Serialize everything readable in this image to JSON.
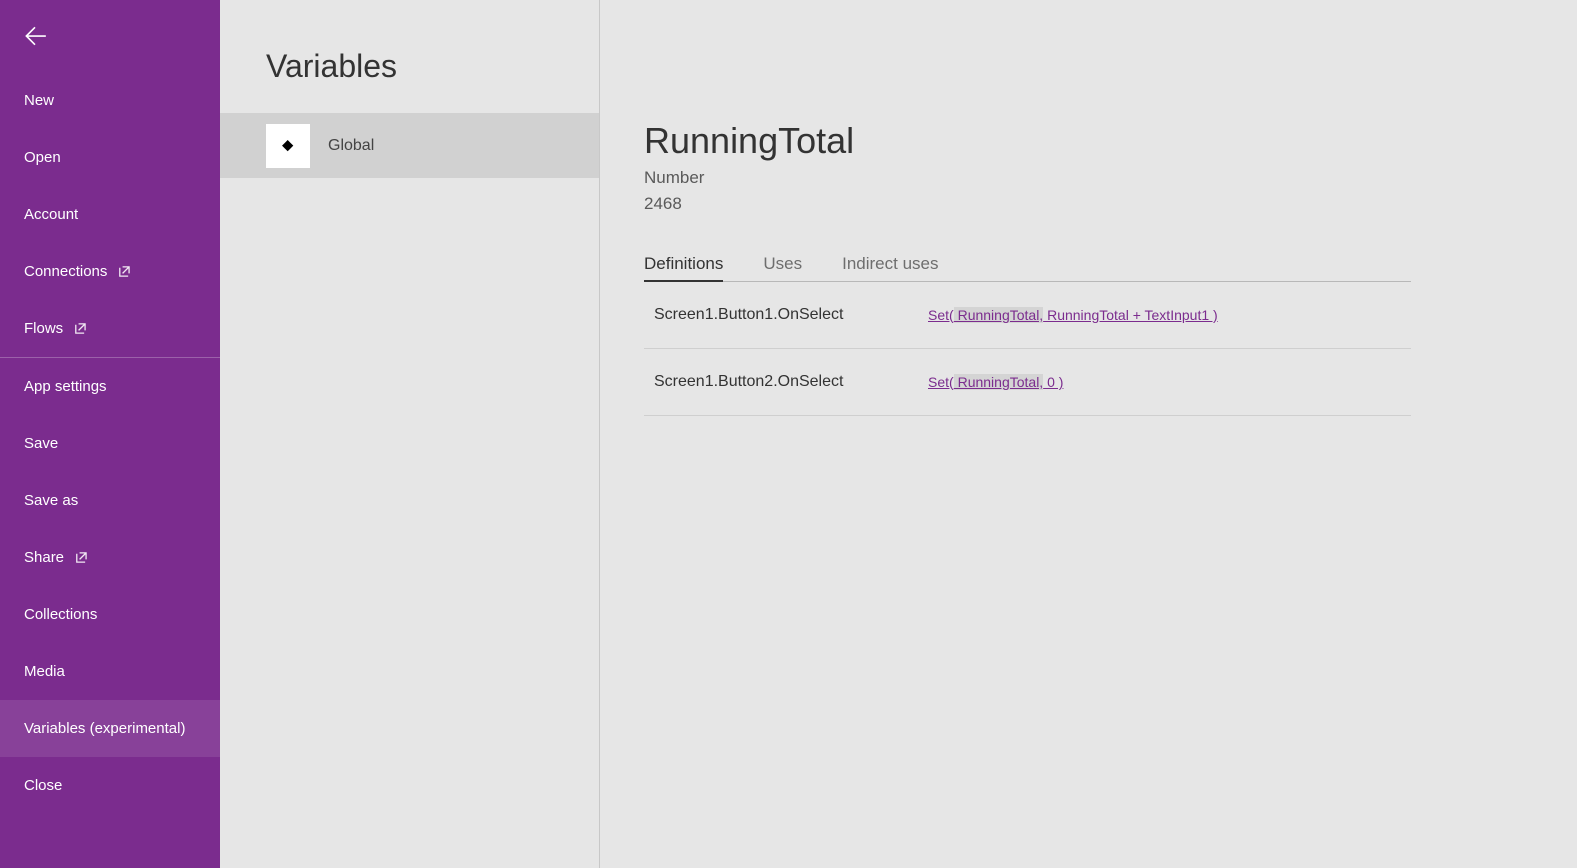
{
  "sidebar": {
    "items": [
      {
        "label": "New"
      },
      {
        "label": "Open"
      },
      {
        "label": "Account"
      },
      {
        "label": "Connections",
        "external": true
      },
      {
        "label": "Flows",
        "external": true,
        "sepAfter": true
      },
      {
        "label": "App settings"
      },
      {
        "label": "Save"
      },
      {
        "label": "Save as"
      },
      {
        "label": "Share",
        "external": true
      },
      {
        "label": "Collections"
      },
      {
        "label": "Media"
      },
      {
        "label": "Variables (experimental)",
        "selected": true
      },
      {
        "label": "Close"
      }
    ]
  },
  "column": {
    "title": "Variables",
    "scopes": [
      {
        "label": "Global",
        "selected": true
      }
    ]
  },
  "detail": {
    "name": "RunningTotal",
    "type": "Number",
    "value": "2468",
    "tabs": [
      {
        "label": "Definitions",
        "selected": true
      },
      {
        "label": "Uses"
      },
      {
        "label": "Indirect uses"
      }
    ],
    "definitions": [
      {
        "path": "Screen1.Button1.OnSelect",
        "formula_pre": "Set(",
        "formula_hl": " RunningTotal,",
        "formula_post": " RunningTotal + TextInput1 )"
      },
      {
        "path": "Screen1.Button2.OnSelect",
        "formula_pre": "Set(",
        "formula_hl": " RunningTotal,",
        "formula_post": " 0 )"
      }
    ]
  }
}
